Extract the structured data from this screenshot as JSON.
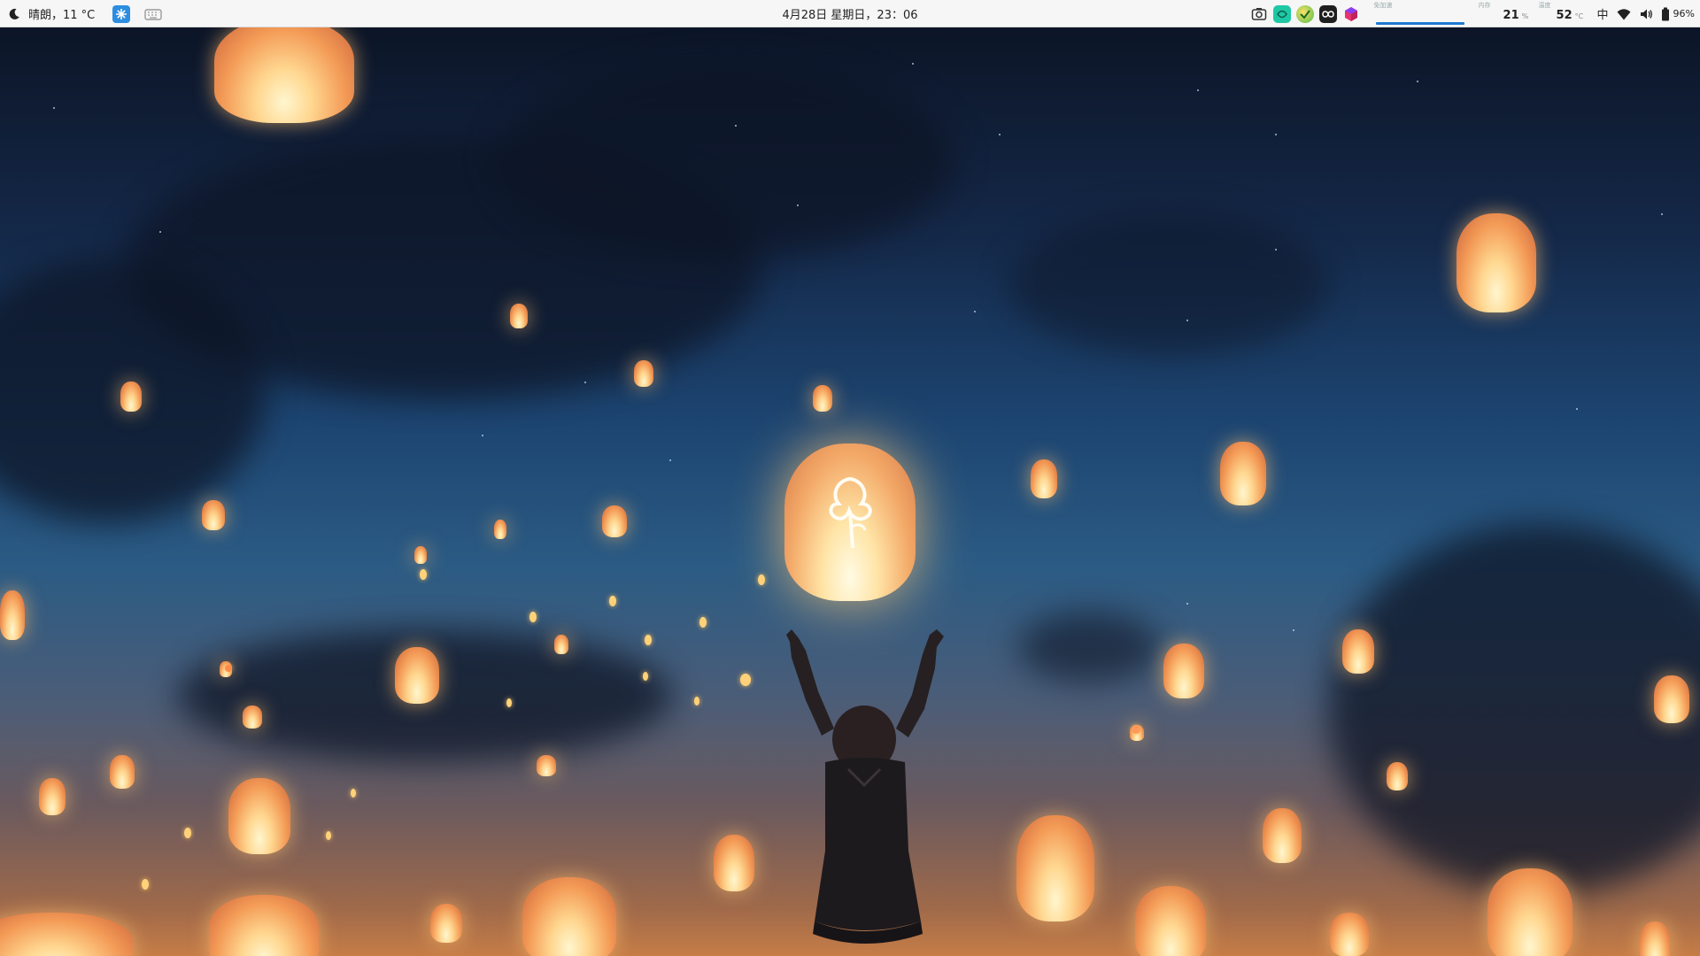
{
  "topbar": {
    "weather": "晴朗，11 °C",
    "datetime": "4月28日 星期日，23：06",
    "network_label": "免加速",
    "memory_label": "内存",
    "memory_value": "21",
    "memory_unit": "%",
    "cpu_temp_label": "温度",
    "cpu_temp_value": "52",
    "cpu_temp_unit": "°C",
    "input_method": "中",
    "battery_percent": "96%",
    "icons": {
      "weather": "moon-icon",
      "tray_1": "flake-app-icon",
      "tray_2": "keyboard-icon",
      "app_1": "screenshot-icon",
      "app_2": "teal-app-icon",
      "app_3": "green-check-app-icon",
      "app_4": "infinity-app-icon",
      "app_5": "cube-app-icon",
      "wifi": "wifi-icon",
      "volume": "volume-icon",
      "battery": "battery-icon"
    }
  },
  "colors": {
    "topbar_bg": "#f6f6f6",
    "sky_top": "#0c1527",
    "sky_mid": "#1c4470",
    "horizon": "#c67d47",
    "lantern_glow": "#ffd790",
    "network_bar": "#1e7ad1"
  },
  "wallpaper": {
    "subject": "sky lanterns at night with girl raising arms"
  }
}
